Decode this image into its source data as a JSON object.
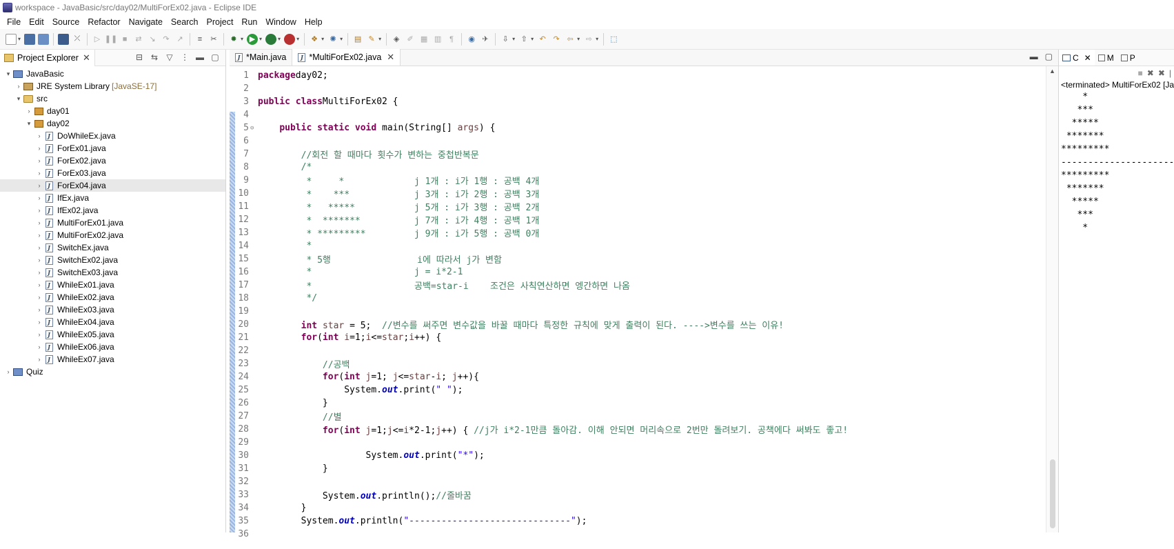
{
  "window": {
    "title": "workspace - JavaBasic/src/day02/MultiForEx02.java - Eclipse IDE"
  },
  "menu": [
    "File",
    "Edit",
    "Source",
    "Refactor",
    "Navigate",
    "Search",
    "Project",
    "Run",
    "Window",
    "Help"
  ],
  "explorer": {
    "tab_label": "Project Explorer",
    "tree": [
      {
        "label": "JavaBasic",
        "kind": "project",
        "depth": 0,
        "arrow": "▾"
      },
      {
        "label": "JRE System Library",
        "tag": "[JavaSE-17]",
        "kind": "library",
        "depth": 1,
        "arrow": "›"
      },
      {
        "label": "src",
        "kind": "folder",
        "depth": 1,
        "arrow": "▾"
      },
      {
        "label": "day01",
        "kind": "package",
        "depth": 2,
        "arrow": "›"
      },
      {
        "label": "day02",
        "kind": "package",
        "depth": 2,
        "arrow": "▾"
      },
      {
        "label": "DoWhileEx.java",
        "kind": "java",
        "depth": 3,
        "arrow": "›"
      },
      {
        "label": "ForEx01.java",
        "kind": "java",
        "depth": 3,
        "arrow": "›"
      },
      {
        "label": "ForEx02.java",
        "kind": "java",
        "depth": 3,
        "arrow": "›"
      },
      {
        "label": "ForEx03.java",
        "kind": "java",
        "depth": 3,
        "arrow": "›"
      },
      {
        "label": "ForEx04.java",
        "kind": "java",
        "depth": 3,
        "arrow": "›",
        "selected": true
      },
      {
        "label": "IfEx.java",
        "kind": "java",
        "depth": 3,
        "arrow": "›"
      },
      {
        "label": "IfEx02.java",
        "kind": "java",
        "depth": 3,
        "arrow": "›"
      },
      {
        "label": "MultiForEx01.java",
        "kind": "java",
        "depth": 3,
        "arrow": "›"
      },
      {
        "label": "MultiForEx02.java",
        "kind": "java",
        "depth": 3,
        "arrow": "›"
      },
      {
        "label": "SwitchEx.java",
        "kind": "java",
        "depth": 3,
        "arrow": "›"
      },
      {
        "label": "SwitchEx02.java",
        "kind": "java",
        "depth": 3,
        "arrow": "›"
      },
      {
        "label": "SwitchEx03.java",
        "kind": "java",
        "depth": 3,
        "arrow": "›"
      },
      {
        "label": "WhileEx01.java",
        "kind": "java",
        "depth": 3,
        "arrow": "›"
      },
      {
        "label": "WhileEx02.java",
        "kind": "java",
        "depth": 3,
        "arrow": "›"
      },
      {
        "label": "WhileEx03.java",
        "kind": "java",
        "depth": 3,
        "arrow": "›"
      },
      {
        "label": "WhileEx04.java",
        "kind": "java",
        "depth": 3,
        "arrow": "›"
      },
      {
        "label": "WhileEx05.java",
        "kind": "java",
        "depth": 3,
        "arrow": "›"
      },
      {
        "label": "WhileEx06.java",
        "kind": "java",
        "depth": 3,
        "arrow": "›"
      },
      {
        "label": "WhileEx07.java",
        "kind": "java",
        "depth": 3,
        "arrow": "›"
      },
      {
        "label": "Quiz",
        "kind": "project",
        "depth": 0,
        "arrow": "›"
      }
    ]
  },
  "editor": {
    "tabs": [
      {
        "label": "*Main.java",
        "active": false
      },
      {
        "label": "*MultiForEx02.java",
        "active": true
      }
    ],
    "lines": [
      [
        [
          "kw",
          "package"
        ],
        [
          "",
          "day02;"
        ]
      ],
      [],
      [
        [
          "kw",
          "public class"
        ],
        [
          "",
          "MultiForEx02 {"
        ]
      ],
      [],
      [
        [
          "",
          "    "
        ],
        [
          "kw",
          "public static void"
        ],
        [
          "",
          " main(String[] "
        ],
        [
          "vr",
          "args"
        ],
        [
          "",
          ") {"
        ]
      ],
      [],
      [
        [
          "",
          "        "
        ],
        [
          "cm",
          "//회전 할 때마다 횟수가 변하는 중첩반복문"
        ]
      ],
      [
        [
          "",
          "        "
        ],
        [
          "cm",
          "/*"
        ]
      ],
      [
        [
          "",
          "         "
        ],
        [
          "cm",
          "*     *             j 1개 : i가 1행 : 공백 4개"
        ]
      ],
      [
        [
          "",
          "         "
        ],
        [
          "cm",
          "*    ***            j 3개 : i가 2행 : 공백 3개"
        ]
      ],
      [
        [
          "",
          "         "
        ],
        [
          "cm",
          "*   *****           j 5개 : i가 3행 : 공백 2개"
        ]
      ],
      [
        [
          "",
          "         "
        ],
        [
          "cm",
          "*  *******          j 7개 : i가 4행 : 공백 1개"
        ]
      ],
      [
        [
          "",
          "         "
        ],
        [
          "cm",
          "* *********         j 9개 : i가 5행 : 공백 0개"
        ]
      ],
      [
        [
          "",
          "         "
        ],
        [
          "cm",
          "*"
        ]
      ],
      [
        [
          "",
          "         "
        ],
        [
          "cm",
          "* 5행                i에 따라서 j가 변함"
        ]
      ],
      [
        [
          "",
          "         "
        ],
        [
          "cm",
          "*                   j = i*2-1"
        ]
      ],
      [
        [
          "",
          "         "
        ],
        [
          "cm",
          "*                   공백=star-i    조건은 사칙연산하면 엥간하면 나옴"
        ]
      ],
      [
        [
          "",
          "         "
        ],
        [
          "cm",
          "*/"
        ]
      ],
      [],
      [
        [
          "",
          "        "
        ],
        [
          "kw",
          "int"
        ],
        [
          "",
          " "
        ],
        [
          "vr",
          "star"
        ],
        [
          "",
          " = 5;  "
        ],
        [
          "cm",
          "//변수를 써주면 변수값을 바꿀 때마다 특정한 규칙에 맞게 출력이 된다. ---->변수를 쓰는 이유!"
        ]
      ],
      [
        [
          "",
          "        "
        ],
        [
          "kw",
          "for"
        ],
        [
          "",
          "("
        ],
        [
          "kw",
          "int"
        ],
        [
          "",
          " "
        ],
        [
          "vr",
          "i"
        ],
        [
          "",
          "=1;"
        ],
        [
          "vr",
          "i"
        ],
        [
          "",
          "<="
        ],
        [
          "vr",
          "star"
        ],
        [
          "",
          ";"
        ],
        [
          "vr",
          "i"
        ],
        [
          "",
          "++) {"
        ]
      ],
      [],
      [
        [
          "",
          "            "
        ],
        [
          "cm",
          "//공백"
        ]
      ],
      [
        [
          "",
          "            "
        ],
        [
          "kw",
          "for"
        ],
        [
          "",
          "("
        ],
        [
          "kw",
          "int"
        ],
        [
          "",
          " "
        ],
        [
          "vr",
          "j"
        ],
        [
          "",
          "=1; "
        ],
        [
          "vr",
          "j"
        ],
        [
          "",
          "<="
        ],
        [
          "vr",
          "star"
        ],
        [
          "",
          "-"
        ],
        [
          "vr",
          "i"
        ],
        [
          "",
          "; "
        ],
        [
          "vr",
          "j"
        ],
        [
          "",
          "++){"
        ]
      ],
      [
        [
          "",
          "                System."
        ],
        [
          "fi",
          "out"
        ],
        [
          "",
          ".print("
        ],
        [
          "st",
          "\" \""
        ],
        [
          "",
          ");"
        ]
      ],
      [
        [
          "",
          "            }"
        ]
      ],
      [
        [
          "",
          "            "
        ],
        [
          "cm",
          "//별"
        ]
      ],
      [
        [
          "",
          "            "
        ],
        [
          "kw",
          "for"
        ],
        [
          "",
          "("
        ],
        [
          "kw",
          "int"
        ],
        [
          "",
          " "
        ],
        [
          "vr",
          "j"
        ],
        [
          "",
          "=1;"
        ],
        [
          "vr",
          "j"
        ],
        [
          "",
          "<="
        ],
        [
          "vr",
          "i"
        ],
        [
          "",
          "*2-1;"
        ],
        [
          "vr",
          "j"
        ],
        [
          "",
          "++) { "
        ],
        [
          "cm",
          "//j가 i*2-1만큼 돌아감. 이해 안되면 머리속으로 2번만 돌려보기. 공책에다 써봐도 좋고!"
        ]
      ],
      [],
      [
        [
          "",
          "                    System."
        ],
        [
          "fi",
          "out"
        ],
        [
          "",
          ".print("
        ],
        [
          "st",
          "\"*\""
        ],
        [
          "",
          ");"
        ]
      ],
      [
        [
          "",
          "            }"
        ]
      ],
      [],
      [
        [
          "",
          "            System."
        ],
        [
          "fi",
          "out"
        ],
        [
          "",
          ".println();"
        ],
        [
          "cm",
          "//줄바꿈"
        ]
      ],
      [
        [
          "",
          "        }"
        ]
      ],
      [
        [
          "",
          "        System."
        ],
        [
          "fi",
          "out"
        ],
        [
          "",
          ".println("
        ],
        [
          "st",
          "\"------------------------------\""
        ],
        [
          "",
          ");"
        ]
      ],
      []
    ]
  },
  "console": {
    "tabs": [
      "C",
      "M",
      "P"
    ],
    "status": "<terminated> MultiForEx02 [Ja",
    "output": [
      "    *",
      "   ***",
      "  *****",
      " *******",
      "*********",
      "------------------------------",
      "*********",
      " *******",
      "  *****",
      "   ***",
      "    *"
    ]
  }
}
